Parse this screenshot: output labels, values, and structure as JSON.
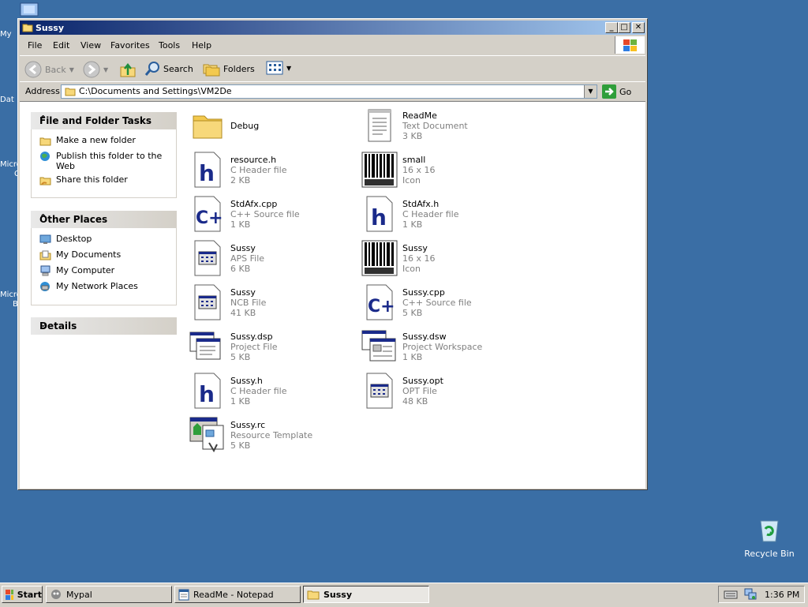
{
  "desktop": {
    "edge_labels": [
      "My",
      "Dat",
      "Micro",
      "C",
      "Micro",
      "B"
    ],
    "recycle_bin_label": "Recycle Bin"
  },
  "window": {
    "title": "Sussy",
    "menu": [
      "File",
      "Edit",
      "View",
      "Favorites",
      "Tools",
      "Help"
    ],
    "toolbar": {
      "back": "Back",
      "search": "Search",
      "folders": "Folders"
    },
    "address": {
      "label": "Address",
      "value": "C:\\Documents and Settings\\VM2De",
      "go": "Go"
    }
  },
  "tasks_panel": {
    "file_folder": {
      "title": "File and Folder Tasks",
      "links": [
        "Make a new folder",
        "Publish this folder to the Web",
        "Share this folder"
      ]
    },
    "other_places": {
      "title": "Other Places",
      "links": [
        "Desktop",
        "My Documents",
        "My Computer",
        "My Network Places"
      ]
    },
    "details": {
      "title": "Details"
    }
  },
  "files": [
    {
      "name": "Debug",
      "type": "",
      "size": "",
      "icon": "folder-icon"
    },
    {
      "name": "ReadMe",
      "type": "Text Document",
      "size": "3 KB",
      "icon": "text-document-icon"
    },
    {
      "name": "resource.h",
      "type": "C Header file",
      "size": "2 KB",
      "icon": "c-header-icon"
    },
    {
      "name": "small",
      "type": "16 x 16",
      "size": "Icon",
      "icon": "barcode-icon"
    },
    {
      "name": "StdAfx.cpp",
      "type": "C++ Source file",
      "size": "1 KB",
      "icon": "cpp-source-icon"
    },
    {
      "name": "StdAfx.h",
      "type": "C Header file",
      "size": "1 KB",
      "icon": "c-header-icon"
    },
    {
      "name": "Sussy",
      "type": "APS File",
      "size": "6 KB",
      "icon": "generic-file-icon"
    },
    {
      "name": "Sussy",
      "type": "16 x 16",
      "size": "Icon",
      "icon": "barcode-icon"
    },
    {
      "name": "Sussy",
      "type": "NCB File",
      "size": "41 KB",
      "icon": "generic-file-icon"
    },
    {
      "name": "Sussy.cpp",
      "type": "C++ Source file",
      "size": "5 KB",
      "icon": "cpp-source-icon"
    },
    {
      "name": "Sussy.dsp",
      "type": "Project File",
      "size": "5 KB",
      "icon": "project-file-icon"
    },
    {
      "name": "Sussy.dsw",
      "type": "Project Workspace",
      "size": "1 KB",
      "icon": "project-workspace-icon"
    },
    {
      "name": "Sussy.h",
      "type": "C Header file",
      "size": "1 KB",
      "icon": "c-header-icon"
    },
    {
      "name": "Sussy.opt",
      "type": "OPT File",
      "size": "48 KB",
      "icon": "generic-file-icon"
    },
    {
      "name": "Sussy.rc",
      "type": "Resource Template",
      "size": "5 KB",
      "icon": "resource-template-icon"
    }
  ],
  "taskbar": {
    "start": "Start",
    "tasks": [
      "Mypal",
      "ReadMe - Notepad",
      "Sussy"
    ],
    "clock": "1:36 PM"
  }
}
